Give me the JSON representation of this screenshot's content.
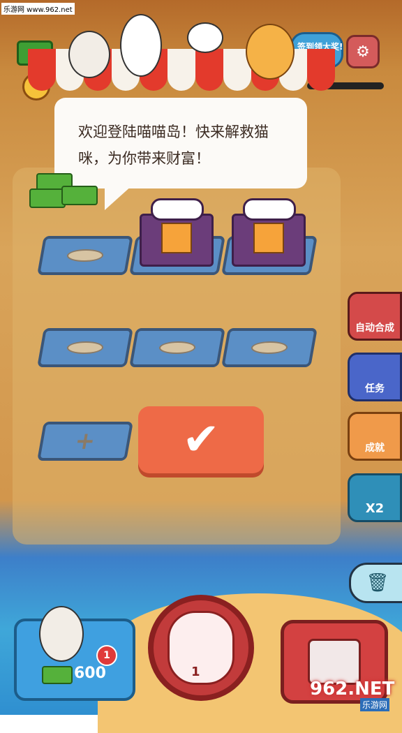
{
  "watermark": "乐游网 www.962.net",
  "header": {
    "sign_label": "签到领大奖!",
    "settings_icon": "gear-icon"
  },
  "welcome": {
    "message": "欢迎登陆喵喵岛！快来解救猫咪，为你带来财富！"
  },
  "side_buttons": {
    "auto_merge": "自动合成",
    "tasks": "任务",
    "achievements": "成就",
    "double": "X2"
  },
  "confirm": {
    "icon": "checkmark-icon"
  },
  "bottom": {
    "buy_price": "600",
    "buy_badge": "1",
    "paw_count": "1"
  },
  "brand": {
    "logo_text": "962.NET",
    "logo_sub": "乐游网"
  },
  "colors": {
    "confirm": "#ee6a47",
    "awning_red": "#e33a2c",
    "paw_red": "#c23b3b"
  }
}
